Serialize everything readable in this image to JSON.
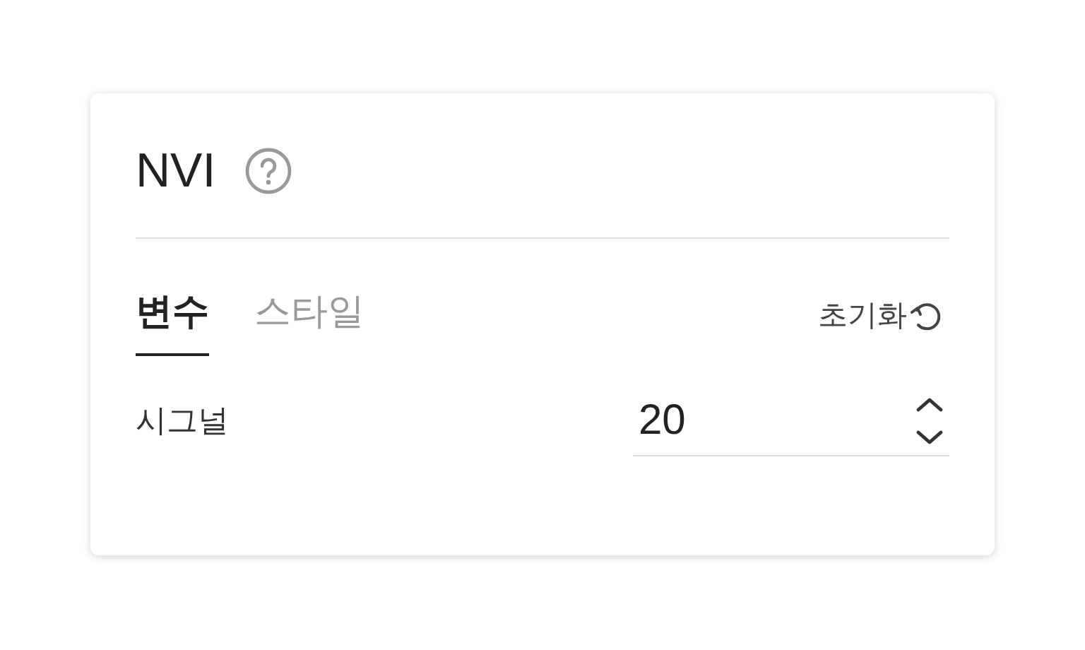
{
  "panel": {
    "title": "NVI"
  },
  "tabs": [
    {
      "label": "변수",
      "selected": true
    },
    {
      "label": "스타일",
      "selected": false
    }
  ],
  "reset_button": {
    "label": "초기화"
  },
  "fields": [
    {
      "label": "시그널",
      "value": "20"
    }
  ]
}
